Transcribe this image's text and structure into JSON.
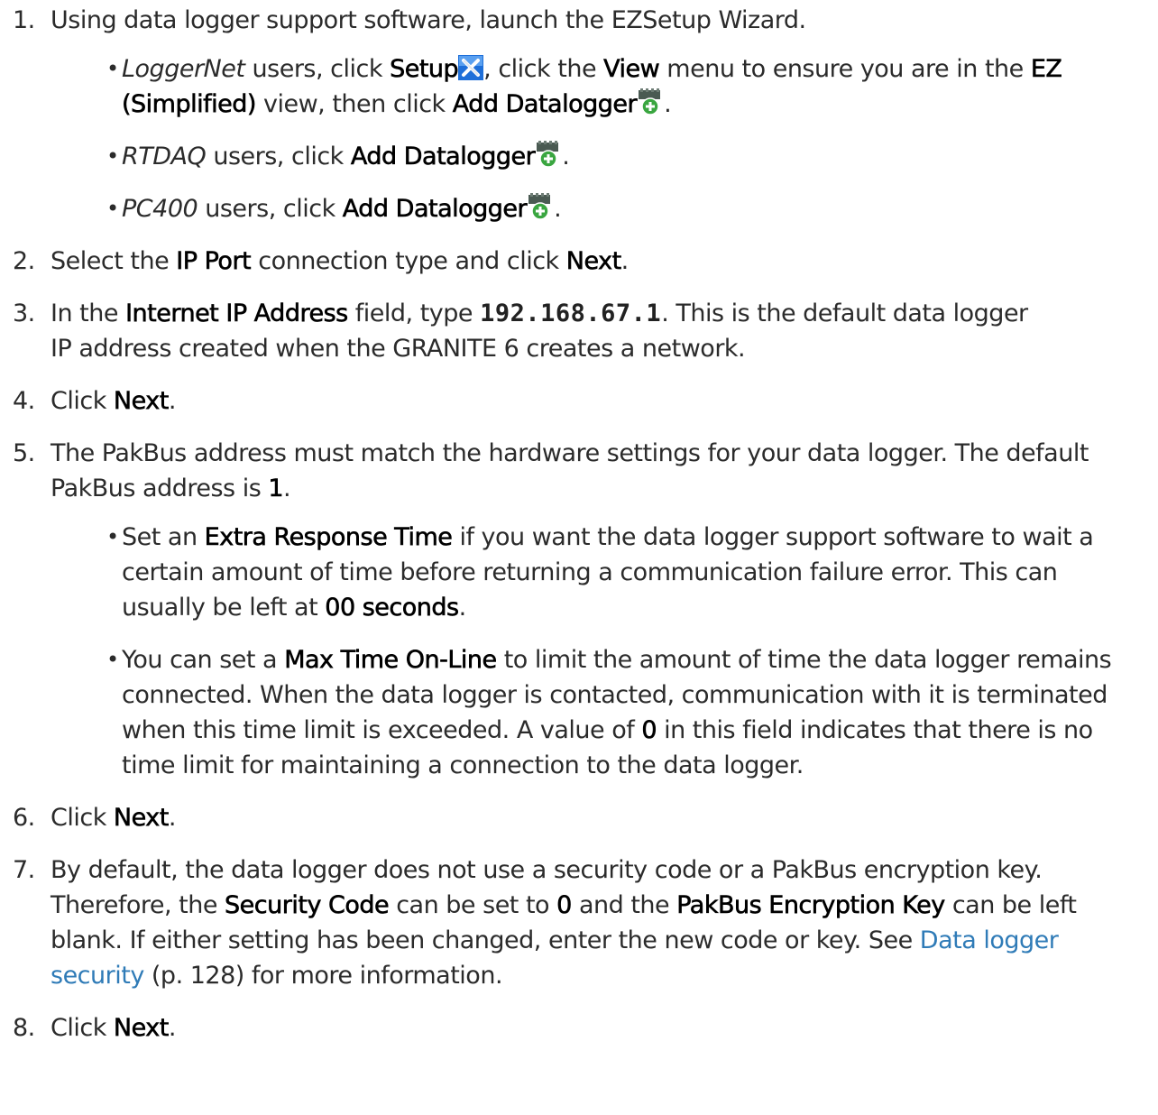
{
  "steps": [
    {
      "num": "1.",
      "text": "Using data logger support software, launch the EZSetup Wizard."
    },
    {
      "num": "2.",
      "t1": "Select the ",
      "b1": "IP Port",
      "t2": " connection type and click ",
      "b2": "Next",
      "t3": "."
    },
    {
      "num": "3.",
      "t1": "In the ",
      "b1": "Internet IP Address",
      "t2": " field, type ",
      "code": "192.168.67.1",
      "t3": ". This is the default data logger",
      "t4": "IP address created when the GRANITE 6 creates a network."
    },
    {
      "num": "4.",
      "t1": "Click ",
      "b1": "Next",
      "t2": "."
    },
    {
      "num": "5.",
      "t1": "The PakBus address must match the hardware settings for your data logger. The default",
      "t2": "PakBus address is ",
      "b1": "1",
      "t3": "."
    },
    {
      "num": "6.",
      "t1": "Click ",
      "b1": "Next",
      "t2": "."
    },
    {
      "num": "7.",
      "t1": "By default, the data logger does not use a security code or a PakBus encryption key.",
      "t2": "Therefore, the ",
      "b1": "Security Code",
      "t3": " can be set to ",
      "b2": "0",
      "t4": " and the ",
      "b3": "PakBus Encryption Key",
      "t5": " can be left",
      "t6": "blank. If either setting has been changed, enter the new code or key. See ",
      "link": "Data logger",
      "link2": "security",
      "t7": " (p. 128) for more information."
    },
    {
      "num": "8.",
      "t1": "Click ",
      "b1": "Next",
      "t2": "."
    }
  ],
  "step1_bullets": [
    {
      "i": "LoggerNet",
      "t1": " users, click ",
      "b1": "Setup",
      "t2": ", click the ",
      "b2": "View",
      "t3": " menu to ensure you are in the ",
      "b3": "EZ",
      "b4": "(Simplified)",
      "t4": " view, then click ",
      "b5": "Add Datalogger",
      "t5": "."
    },
    {
      "i": "RTDAQ",
      "t1": " users, click ",
      "b1": "Add Datalogger",
      "t2": "."
    },
    {
      "i": "PC400",
      "t1": " users, click ",
      "b1": "Add Datalogger",
      "t2": "."
    }
  ],
  "step5_bullets": [
    {
      "t1": "Set an ",
      "b1": "Extra Response Time",
      "t2": " if you want the data logger support software to wait a",
      "t3": "certain amount of time before returning a communication failure error. This can",
      "t4": "usually be left at ",
      "b2": "00 seconds",
      "t5": "."
    },
    {
      "t1": "You can set a ",
      "b1": "Max Time On-Line",
      "t2": " to limit the amount of time the data logger remains",
      "t3": "connected. When the data logger is contacted, communication with it is terminated",
      "t4": "when this time limit is exceeded. A value of ",
      "b2": "0",
      "t5": " in this field indicates that there is no",
      "t6": "time limit for maintaining a connection to the data logger."
    }
  ],
  "bullet_glyph": "•",
  "icons": {
    "setup": "setup-tools-icon",
    "add": "add-datalogger-icon"
  },
  "colors": {
    "link": "#2f7bb7",
    "setup_icon_bg": "#1e6fd9",
    "add_icon_green": "#3aa640"
  }
}
